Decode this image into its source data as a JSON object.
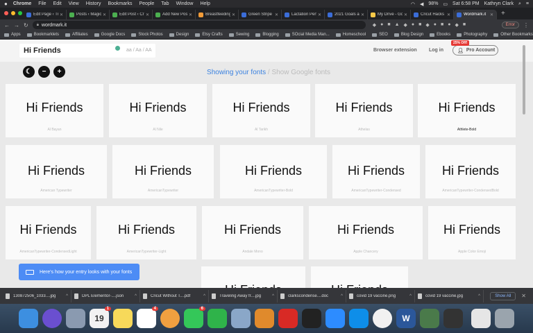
{
  "menubar": {
    "apple": "",
    "items": [
      "Chrome",
      "File",
      "Edit",
      "View",
      "History",
      "Bookmarks",
      "People",
      "Tab",
      "Window",
      "Help"
    ],
    "battery": "98%",
    "clock": "Sat 6:58 PM",
    "user": "Kathryn Clark"
  },
  "tabs": [
    {
      "title": "Edit Page ‹ Tr",
      "color": "#3b6dd8"
    },
    {
      "title": "Posts ‹ Magic",
      "color": "#4caf50"
    },
    {
      "title": "Edit Post ‹ Cr",
      "color": "#4caf50"
    },
    {
      "title": "Add New Post",
      "color": "#4caf50"
    },
    {
      "title": "Breastfeeding",
      "color": "#f29b38"
    },
    {
      "title": "Green Stripe",
      "color": "#3b6dd8"
    },
    {
      "title": "Lactation Perf",
      "color": "#3b6dd8"
    },
    {
      "title": "2021 Goals an",
      "color": "#3b6dd8"
    },
    {
      "title": "My Drive - Go",
      "color": "#f7c948"
    },
    {
      "title": "Cricut Hacks",
      "color": "#3b6dd8"
    },
    {
      "title": "Wordmark.it",
      "color": "#3b6dd8"
    }
  ],
  "toolbar": {
    "url": "wordmark.it",
    "error_label": "Error"
  },
  "bookmarks": {
    "items": [
      "Apps",
      "Bookmarklets",
      "Affiliates",
      "Google Docs",
      "Stock Photos",
      "Design",
      "Etsy Crafts",
      "Sewing",
      "Blogging",
      "SOcial Media Man...",
      "Homeschool",
      "SEO",
      "Blog Design",
      "Ebooks",
      "Photography"
    ],
    "other": "Other Bookmarks"
  },
  "site": {
    "preview_text": "Hi Friends",
    "case_options": "aa / Aa / AA",
    "browser_extension": "Browser extension",
    "login": "Log in",
    "pro_account": "Pro Account",
    "pro_badge": "25% Off!",
    "toggle_on": "Showing your fonts",
    "toggle_sep": "/",
    "toggle_off": "Show Google fonts",
    "toast": "Here's how your entry looks with your fonts",
    "cards": [
      {
        "font": "Al Bayan",
        "sample": "Hi Friends"
      },
      {
        "font": "Al Nile",
        "sample": "Hi Friends"
      },
      {
        "font": "Al Tarikh",
        "sample": "Hi Friends"
      },
      {
        "font": "Athelas",
        "sample": "Hi Friends"
      },
      {
        "font": "Athlete-Bold",
        "sample": "Hi Friends"
      },
      {
        "font": "American Typewriter",
        "sample": "Hi Friends"
      },
      {
        "font": "AmericanTypewriter",
        "sample": "Hi Friends"
      },
      {
        "font": "AmericanTypewriter-Bold",
        "sample": "Hi Friends"
      },
      {
        "font": "AmericanTypewriter-Condensed",
        "sample": "Hi Friends"
      },
      {
        "font": "AmericanTypewriter-CondensedBold",
        "sample": "Hi Friends"
      },
      {
        "font": "AmericanTypewriter-CondensedLight",
        "sample": "Hi Friends"
      },
      {
        "font": "AmericanTypewriter-Light",
        "sample": "Hi Friends"
      },
      {
        "font": "Andale Mono",
        "sample": "Hi Friends"
      },
      {
        "font": "Apple Chancery",
        "sample": "Hi Friends"
      },
      {
        "font": "Apple Color Emoji",
        "sample": "Hi Friends"
      },
      {
        "font": "",
        "sample": "Hi Friends"
      },
      {
        "font": "",
        "sample": "Hi Friends"
      }
    ]
  },
  "downloads": {
    "items": [
      "130872506_1033....jpg",
      "DPL Elementor-....json",
      "Cricut Without T....pdf",
      "Traveling Away fr....jpg",
      "clarkscondense....doc",
      "covid 19 vaccine.png",
      "covid 19 vaccine.jpg"
    ],
    "show_all": "Show All"
  },
  "dock": {
    "apps": [
      {
        "name": "finder",
        "color": "#3d8fe0"
      },
      {
        "name": "siri",
        "color": "#6a4fd0"
      },
      {
        "name": "launchpad",
        "color": "#8a9ab0"
      },
      {
        "name": "calendar",
        "color": "#f2f2f2",
        "label": "19",
        "badge": "1"
      },
      {
        "name": "notes",
        "color": "#f7d95a"
      },
      {
        "name": "reminders",
        "color": "#ffffff",
        "badge": "4"
      },
      {
        "name": "photos",
        "color": "#f0a040"
      },
      {
        "name": "messages",
        "color": "#34c759",
        "badge": "6"
      },
      {
        "name": "facetime",
        "color": "#2fb34a"
      },
      {
        "name": "preview",
        "color": "#8aa7c8"
      },
      {
        "name": "books",
        "color": "#e08a2c"
      },
      {
        "name": "acrobat",
        "color": "#d82a25"
      },
      {
        "name": "terminal",
        "color": "#222222"
      },
      {
        "name": "zoom",
        "color": "#2d8cff"
      },
      {
        "name": "teamviewer",
        "color": "#0e8ee9"
      },
      {
        "name": "chrome",
        "color": "#f1f1f1"
      },
      {
        "name": "word",
        "color": "#2b579a",
        "label": "W"
      },
      {
        "name": "cricut",
        "color": "#4a7a4a"
      },
      {
        "name": "printer",
        "color": "#333333"
      },
      {
        "name": "downloads-stack",
        "color": "#e6e6e6"
      },
      {
        "name": "trash",
        "color": "#9aa4ad"
      }
    ]
  }
}
